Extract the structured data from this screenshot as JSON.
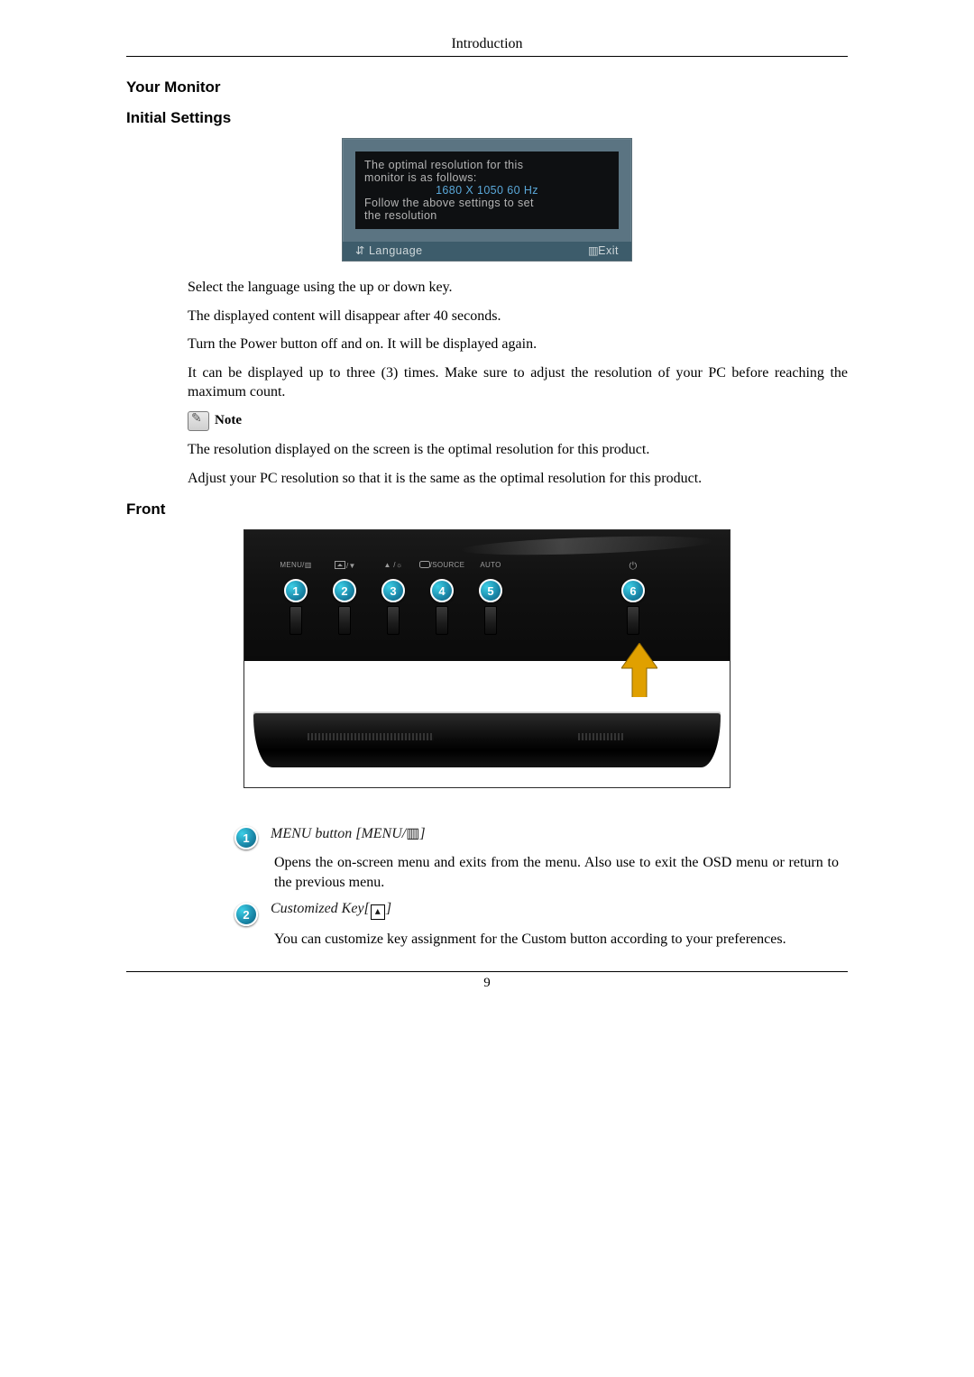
{
  "header": {
    "title": "Introduction"
  },
  "section_your_monitor": "Your Monitor",
  "section_initial_settings": "Initial Settings",
  "osd": {
    "line1": "The optimal resolution for this",
    "line2": "monitor is as follows:",
    "resolution": "1680 X 1050 60 Hz",
    "line3": "Follow the above settings to set",
    "line4": "the resolution",
    "language_label": "Language",
    "exit_label": "Exit"
  },
  "paragraphs": {
    "p1": "Select the language using the up or down key.",
    "p2": "The displayed content will disappear after 40 seconds.",
    "p3": "Turn the Power button off and on. It will be displayed again.",
    "p4": "It can be displayed up to three (3) times. Make sure to adjust the resolution of your PC before reaching the maximum count.",
    "note_label": "Note",
    "p5": "The resolution displayed on the screen is the optimal resolution for this product.",
    "p6": "Adjust your PC resolution so that it is the same as the optimal resolution for this product."
  },
  "section_front": "Front",
  "front_labels": {
    "b1": "MENU/",
    "b2_svg_only": "",
    "b3_svg_only": "",
    "b4": "/SOURCE",
    "b5": "AUTO"
  },
  "front_badges": [
    "1",
    "2",
    "3",
    "4",
    "5",
    "6"
  ],
  "descriptions": {
    "d1_title_pre": "MENU button [MENU/",
    "d1_title_post": "]",
    "d1_body": "Opens the on-screen menu and exits from the menu. Also use to exit the OSD menu or return to the previous menu.",
    "d2_title_pre": "Customized Key[",
    "d2_title_post": "]",
    "d2_body": "You can customize key assignment for the Custom button according to your preferences."
  },
  "page_number": "9"
}
